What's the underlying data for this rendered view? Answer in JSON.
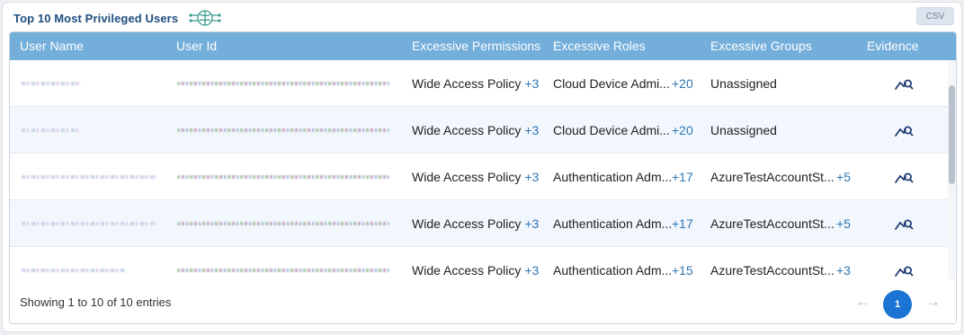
{
  "widget": {
    "title": "Top 10 Most Privileged Users",
    "csv_label": "CSV"
  },
  "columns": {
    "user_name": "User Name",
    "user_id": "User Id",
    "excessive_permissions": "Excessive Permissions",
    "excessive_roles": "Excessive Roles",
    "excessive_groups": "Excessive Groups",
    "evidence": "Evidence"
  },
  "rows": [
    {
      "permission": "Wide Access Policy",
      "permission_more": "+3",
      "role": "Cloud Device Admi...",
      "role_more": "+20",
      "group": "Unassigned",
      "group_more": ""
    },
    {
      "permission": "Wide Access Policy",
      "permission_more": "+3",
      "role": "Cloud Device Admi...",
      "role_more": "+20",
      "group": "Unassigned",
      "group_more": ""
    },
    {
      "permission": "Wide Access Policy",
      "permission_more": "+3",
      "role": "Authentication Adm...",
      "role_more": "+17",
      "group": "AzureTestAccountSt...",
      "group_more": "+5"
    },
    {
      "permission": "Wide Access Policy",
      "permission_more": "+3",
      "role": "Authentication Adm...",
      "role_more": "+17",
      "group": "AzureTestAccountSt...",
      "group_more": "+5"
    },
    {
      "permission": "Wide Access Policy",
      "permission_more": "+3",
      "role": "Authentication Adm...",
      "role_more": "+15",
      "group": "AzureTestAccountSt...",
      "group_more": "+3"
    }
  ],
  "footer": {
    "entries_text": "Showing 1 to 10 of 10 entries",
    "current_page": "1",
    "prev_symbol": "←",
    "next_symbol": "→"
  },
  "colors": {
    "header_bg": "#74aedb",
    "title": "#1f4f7e",
    "accent": "#1b73d3",
    "count_text": "#2f76b4"
  },
  "icons": {
    "title_icon": "brain-circuit-icon",
    "evidence": "chart-magnify-icon"
  }
}
